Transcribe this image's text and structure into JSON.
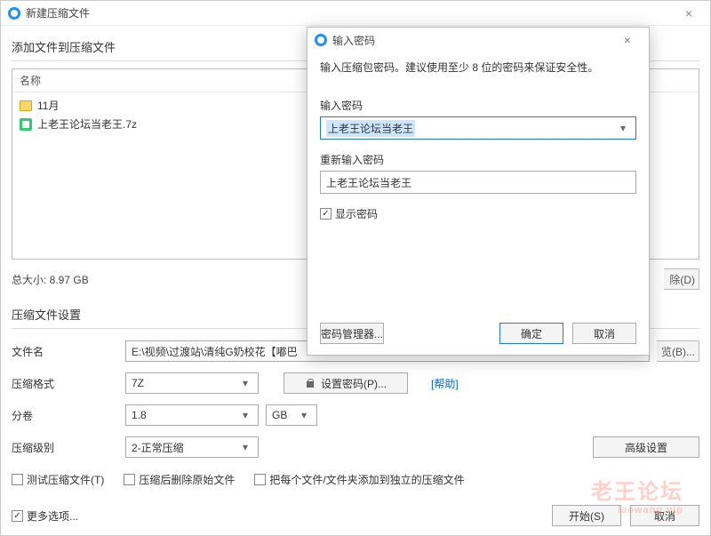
{
  "window": {
    "title": "新建压缩文件",
    "close_glyph": "×"
  },
  "add_section": {
    "heading": "添加文件到压缩文件",
    "name_header": "名称",
    "files": [
      {
        "name": "11月",
        "kind": "folder"
      },
      {
        "name": "上老王论坛当老王.7z",
        "kind": "archive"
      }
    ],
    "total_size_label": "总大小: 8.97 GB",
    "truncated_button": "除(D)"
  },
  "settings": {
    "heading": "压缩文件设置",
    "filename_label": "文件名",
    "filename_value": "E:\\视频\\过渡站\\清纯G奶校花【嘟巴",
    "browse_btn": "览(B)...",
    "format_label": "压缩格式",
    "format_value": "7Z",
    "set_password_btn": "设置密码(P)...",
    "help_link": "[帮助]",
    "split_label": "分卷",
    "split_value": "1.8",
    "split_unit": "GB",
    "level_label": "压缩级别",
    "level_value": "2-正常压缩",
    "advanced_btn": "高级设置",
    "test_archive": "测试压缩文件(T)",
    "delete_after": "压缩后删除原始文件",
    "separate_archives": "把每个文件/文件夹添加到独立的压缩文件",
    "more_options": "更多选项...",
    "start_btn": "开始(S)",
    "cancel_btn": "取消"
  },
  "password_dialog": {
    "title": "输入密码",
    "close_glyph": "×",
    "hint": "输入压缩包密码。建议使用至少 8 位的密码来保证安全性。",
    "pw_label": "输入密码",
    "pw_value": "上老王论坛当老王",
    "pw2_label": "重新输入密码",
    "pw2_value": "上老王论坛当老王",
    "show_pw_label": "显示密码",
    "show_pw_checked": true,
    "manager_btn": "密码管理器...",
    "ok_btn": "确定",
    "cancel_btn": "取消"
  },
  "watermark": {
    "big": "老王论坛",
    "small": "laowang.vip"
  }
}
